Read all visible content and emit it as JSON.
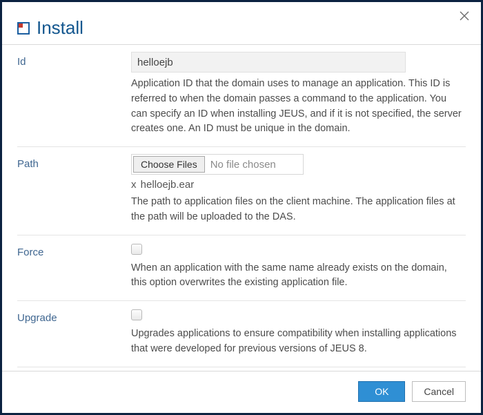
{
  "dialog": {
    "title": "Install"
  },
  "fields": {
    "id": {
      "label": "Id",
      "value": "helloejb",
      "help": "Application ID that the domain uses to manage an application. This ID is referred to when the domain passes a command to the application. You can specify an ID when installing JEUS, and if it is not specified, the server creates one. An ID must be unique in the domain."
    },
    "path": {
      "label": "Path",
      "choose_label": "Choose Files",
      "no_file_text": "No file chosen",
      "selected_file": "helloejb.ear",
      "remove_glyph": "x",
      "help": "The path to application files on the client machine. The application files at the path will be uploaded to the DAS."
    },
    "force": {
      "label": "Force",
      "checked": false,
      "help": "When an application with the same name already exists on the domain, this option overwrites the existing application file."
    },
    "upgrade": {
      "label": "Upgrade",
      "checked": false,
      "help": "Upgrades applications to ensure compatibility when installing applications that were developed for previous versions of JEUS 8."
    }
  },
  "buttons": {
    "ok": "OK",
    "cancel": "Cancel"
  }
}
